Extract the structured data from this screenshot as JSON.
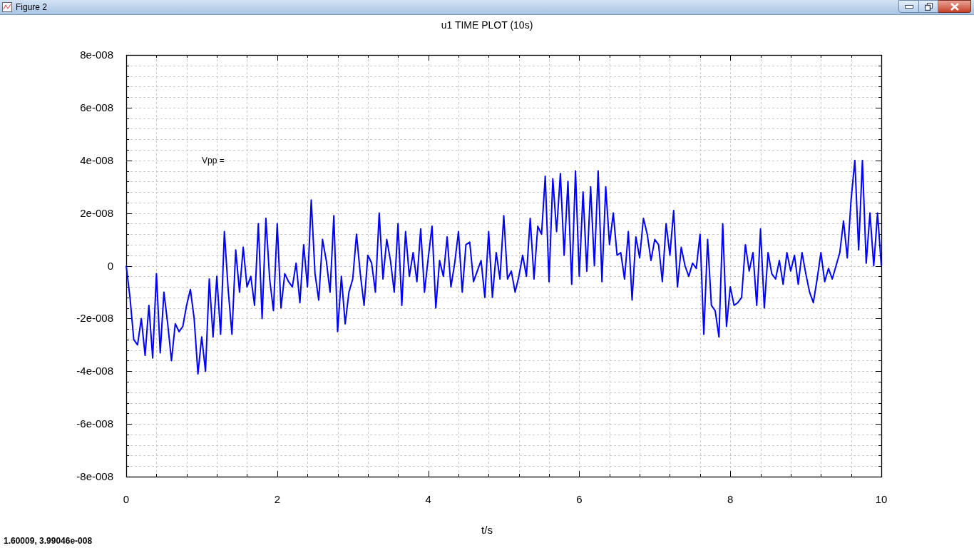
{
  "window": {
    "title": "Figure 2"
  },
  "plot": {
    "title": "u1 TIME PLOT (10s)",
    "y_tick_labels": [
      "8e-008",
      "6e-008",
      "4e-008",
      "2e-008",
      "0",
      "-2e-008",
      "-4e-008",
      "-6e-008",
      "-8e-008"
    ],
    "x_tick_labels": [
      "0",
      "2",
      "4",
      "6",
      "8",
      "10"
    ],
    "x_axis_label": "t/s",
    "annotation": "Vpp ="
  },
  "status_bar": {
    "coordinates": "1.60009,  3.99046e-008"
  }
}
